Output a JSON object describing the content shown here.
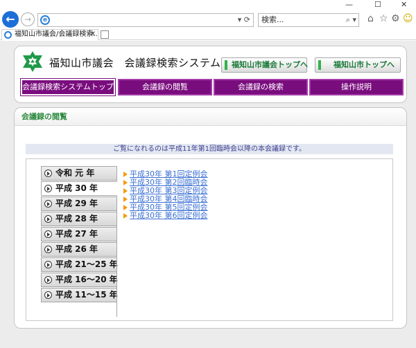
{
  "browser": {
    "window_controls": {
      "minimize": "—",
      "maximize": "☐",
      "close": "✕"
    },
    "search_placeholder": "検索...",
    "tab_title": "福知山市議会/会議録検索...",
    "icons": [
      "back-arrow-icon",
      "forward-arrow-icon",
      "ie-logo-icon",
      "home-icon",
      "star-icon",
      "gear-icon",
      "smiley-icon"
    ]
  },
  "header": {
    "site_title": "福知山市議会　会議録検索システム",
    "links": [
      "福知山市議会トップへ",
      "福知山市トップへ"
    ],
    "nav": [
      "会議録検索システムトップ",
      "会議録の閲覧",
      "会議録の検索",
      "操作説明"
    ],
    "active_nav_index": 0,
    "logo_color": "#1f9a48",
    "nav_color": "#7a0d7e"
  },
  "content": {
    "section_title": "会議録の閲覧",
    "notice": "ご覧になれるのは平成11年第1回臨時会以降の本会議録です。",
    "years": [
      "令和 元 年",
      "平成 30 年",
      "平成 29 年",
      "平成 28 年",
      "平成 27 年",
      "平成 26 年",
      "平成 21～25 年",
      "平成 16～20 年",
      "平成 11～15 年"
    ],
    "selected_year_index": 1,
    "meetings": [
      "平成30年 第1回定例会",
      "平成30年 第2回臨時会",
      "平成30年 第3回定例会",
      "平成30年 第4回臨時会",
      "平成30年 第5回定例会",
      "平成30年 第6回定例会"
    ],
    "link_color": "#3a6fd3"
  }
}
